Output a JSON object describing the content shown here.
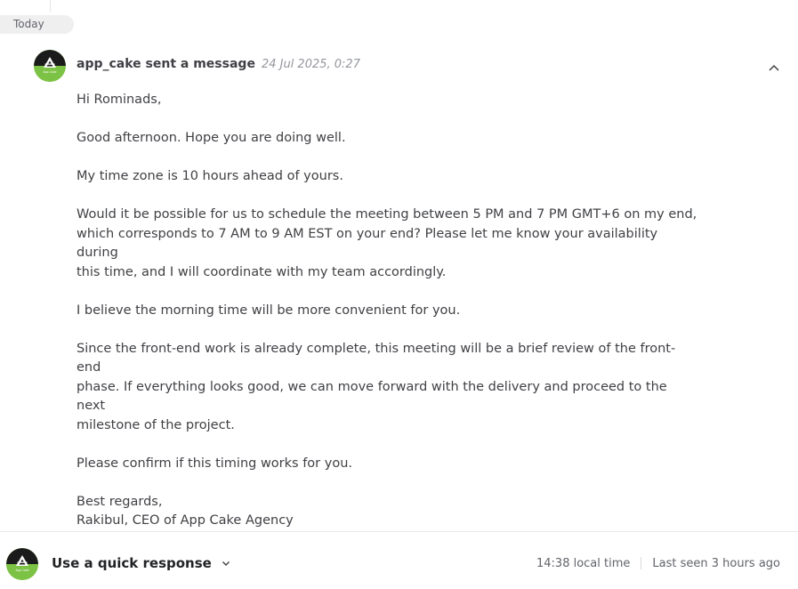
{
  "timeline": {
    "day_label": "Today"
  },
  "message": {
    "sender": "app_cake sent a message",
    "timestamp": "24 Jul 2025, 0:27",
    "avatar_icon": "app-cake-logo",
    "collapse_icon": "chevron-up-icon",
    "paragraphs": [
      "Hi Rominads,",
      "Good afternoon. Hope you are doing well.",
      "My time zone is 10 hours ahead of yours.",
      "Would it be possible for us to schedule the meeting between 5 PM and 7 PM GMT+6 on my end,\nwhich corresponds to 7 AM to 9 AM EST on your end? Please let me know your availability during\nthis time, and I will coordinate with my team accordingly.",
      "I believe the morning time will be more convenient for you.",
      "Since the front-end work is already complete, this meeting will be a brief review of the front-end\nphase. If everything looks good, we can move forward with the delivery and proceed to the next\nmilestone of the project.",
      "Please confirm if this timing works for you.",
      "Best regards,\nRakibul, CEO of App Cake Agency"
    ]
  },
  "footer": {
    "quick_response_label": "Use a quick response",
    "dropdown_icon": "chevron-down-icon",
    "local_time": "14:38 local time",
    "last_seen": "Last seen 3 hours ago"
  },
  "colors": {
    "avatar_bg": "#7cc244",
    "text": "#404145",
    "muted": "#95979d"
  }
}
